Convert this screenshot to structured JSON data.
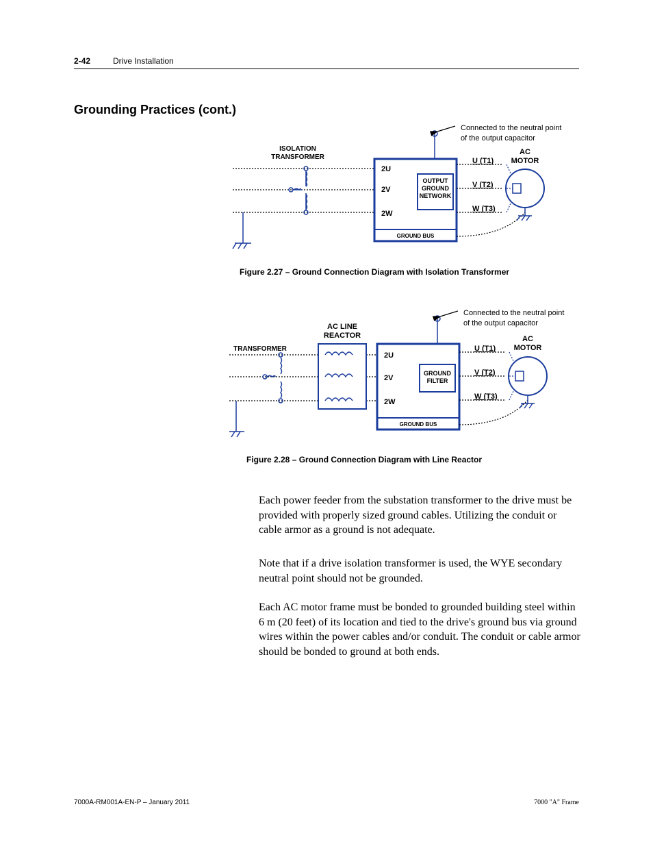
{
  "header": {
    "pageNum": "2-42",
    "chapter": "Drive Installation"
  },
  "section": {
    "title": "Grounding Practices (cont.)"
  },
  "fig1": {
    "caption": "Figure 2.27 – Ground Connection Diagram with Isolation Transformer",
    "note": "Connected to the neutral point of the output capacitor",
    "transformerLabel": "ISOLATION\nTRANSFORMER",
    "motorLabel": "AC\nMOTOR",
    "boxLabel": "OUTPUT\nGROUND\nNETWORK",
    "groundBus": "GROUND BUS",
    "phasesIn": [
      "2U",
      "2V",
      "2W"
    ],
    "phasesOut": [
      "U (T1)",
      "V (T2)",
      "W (T3)"
    ]
  },
  "fig2": {
    "caption": "Figure 2.28 – Ground Connection Diagram with Line Reactor",
    "note": "Connected to the neutral point of the output capacitor",
    "transformerLabel": "TRANSFORMER",
    "reactorLabel": "AC LINE\nREACTOR",
    "motorLabel": "AC\nMOTOR",
    "boxLabel": "GROUND\nFILTER",
    "groundBus": "GROUND BUS",
    "phasesIn": [
      "2U",
      "2V",
      "2W"
    ],
    "phasesOut": [
      "U (T1)",
      "V (T2)",
      "W (T3)"
    ]
  },
  "paragraphs": {
    "p1": "Each power feeder from the substation transformer to the drive must be provided with properly sized ground cables.  Utilizing the conduit or cable armor as a ground is not adequate.",
    "p2": "Note that if a drive isolation transformer is used, the WYE secondary neutral point should not be grounded.",
    "p3": "Each AC motor frame must be bonded to grounded building steel within 6 m (20 feet) of its location and tied to the drive's ground bus via ground wires within the power cables and/or conduit. The conduit or cable armor should be bonded to ground at both ends."
  },
  "footer": {
    "left": "7000A-RM001A-EN-P – January 2011",
    "right": "7000 \"A\" Frame"
  }
}
